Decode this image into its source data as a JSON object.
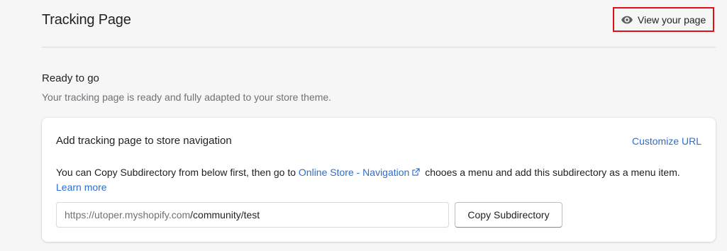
{
  "header": {
    "title": "Tracking Page",
    "view_button_label": "View your page",
    "view_button_icon": "eye-icon",
    "highlight_color": "#e0101a"
  },
  "section": {
    "title": "Ready to go",
    "description": "Your tracking page is ready and fully adapted to your store theme."
  },
  "card": {
    "title": "Add tracking page to store navigation",
    "customize_link": "Customize URL",
    "text_prefix": "You can ",
    "text_bold": "Copy Subdirectory",
    "text_middle": " from below first, then go to ",
    "nav_link": "Online Store - Navigation",
    "nav_link_icon": "external-link-icon",
    "text_suffix": " chooes a menu and add this subdirectory as a menu item. ",
    "learn_more": "Learn more",
    "url_base": "https://utoper.myshopify.com",
    "url_path": "/community/test",
    "copy_button_label": "Copy Subdirectory",
    "link_color": "#2c6ecb"
  }
}
